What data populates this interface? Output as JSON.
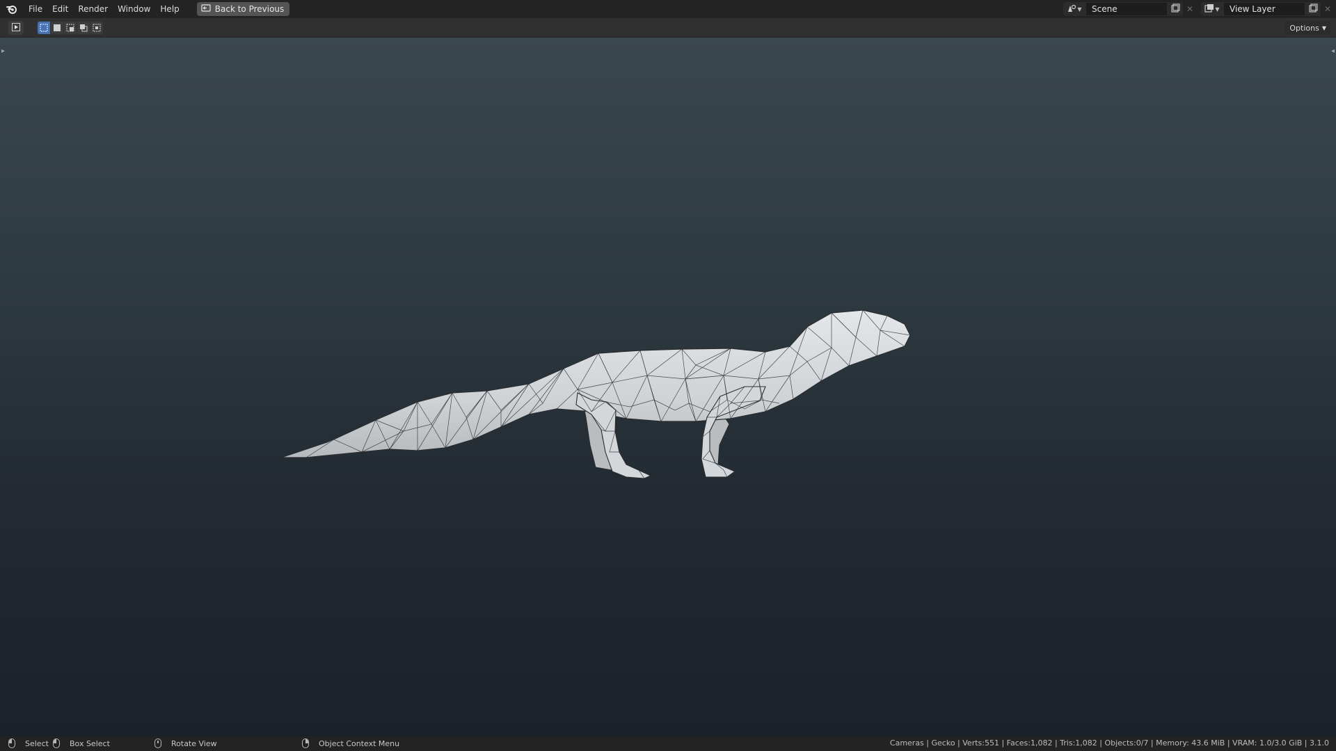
{
  "topbar": {
    "menus": [
      "File",
      "Edit",
      "Render",
      "Window",
      "Help"
    ],
    "back_button_label": "Back to Previous",
    "scene_name": "Scene",
    "view_layer_name": "View Layer"
  },
  "header": {
    "options_label": "Options"
  },
  "statusbar": {
    "select_label": "Select",
    "box_select_label": "Box Select",
    "rotate_view_label": "Rotate View",
    "context_menu_label": "Object Context Menu",
    "stats": "Cameras | Gecko | Verts:551 | Faces:1,082 | Tris:1,082 | Objects:0/7 | Memory: 43.6 MiB | VRAM: 1.0/3.0 GiB | 3.1.0"
  },
  "colors": {
    "accent": "#4772b3",
    "mesh_fill": "#d2d6d8",
    "mesh_wire": "#2a2d30"
  },
  "icons": [
    "blender-logo-icon",
    "back-icon",
    "scene-icon",
    "view-layer-icon",
    "new-icon",
    "close-icon",
    "editor-type-icon",
    "mouse-left-icon",
    "mouse-middle-icon",
    "mouse-right-icon"
  ]
}
